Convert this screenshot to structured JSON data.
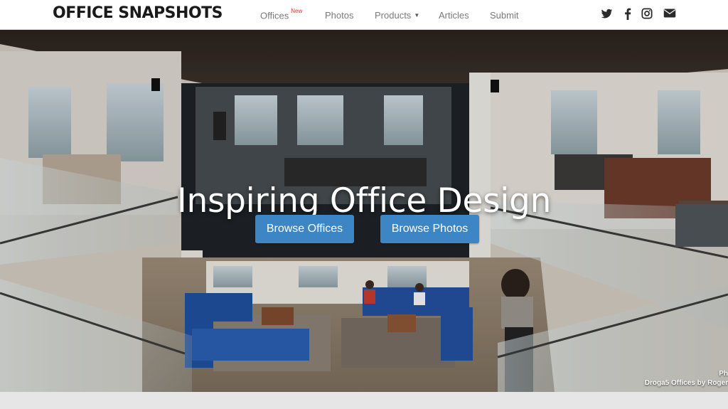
{
  "site": {
    "logo": "OFFICE SNAPSHOTS"
  },
  "nav": {
    "items": [
      {
        "label": "Offices",
        "badge": "New"
      },
      {
        "label": "Photos"
      },
      {
        "label": "Products",
        "dropdown": true
      },
      {
        "label": "Articles"
      },
      {
        "label": "Submit"
      }
    ]
  },
  "social": {
    "icons": [
      "twitter-icon",
      "facebook-icon",
      "instagram-icon",
      "envelope-icon"
    ]
  },
  "hero": {
    "title": "Inspiring Office Design",
    "buttons": [
      {
        "label": "Browse Offices"
      },
      {
        "label": "Browse Photos"
      }
    ],
    "credit_line1": "Ph",
    "credit_line2": "Droga5 Offices by Roger"
  },
  "colors": {
    "accent": "#3d86c6",
    "badge": "#e0303a",
    "nav_text": "#7a7a7a",
    "logo": "#1a1a1a"
  }
}
